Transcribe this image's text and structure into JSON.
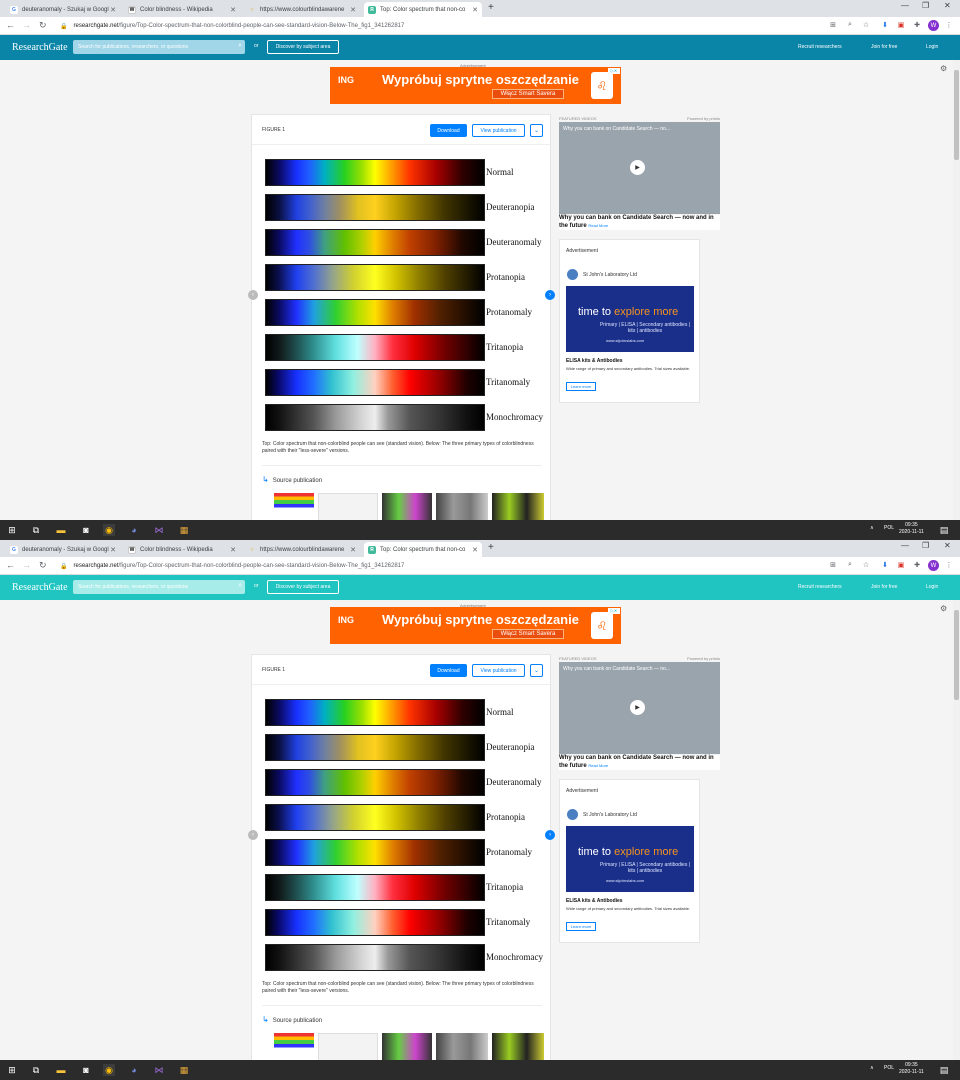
{
  "browser": {
    "tabs": [
      {
        "title": "deuteranomaly - Szukaj w Googl",
        "fav": "G",
        "fav_color": "#ffffff"
      },
      {
        "title": "Color blindness - Wikipedia",
        "fav": "W",
        "fav_color": "#ffffff"
      },
      {
        "title": "https://www.colourblindawarene",
        "fav": "☆",
        "fav_color": "#ffffff"
      },
      {
        "title": "Top: Color spectrum that non-co",
        "fav": "R",
        "fav_color": "#40ba9b"
      }
    ],
    "active_tab": 3,
    "url_host": "researchgate.net",
    "url_path": "/figure/Top-Color-spectrum-that-non-colorblind-people-can-see-standard-vision-Below-The_fig1_341262817",
    "avatar_letter": "W",
    "icons": [
      "back-icon",
      "forward-icon",
      "reload-icon",
      "lock-icon",
      "translate-icon",
      "zoom-icon",
      "star-icon",
      "download-icon",
      "pdf-icon",
      "extensions-icon",
      "menu-icon"
    ]
  },
  "rg": {
    "logo": "ResearchGate",
    "search_placeholder": "Search for publications, researchers, or questions",
    "or": "or",
    "discover": "Discover by subject area",
    "recruit": "Recruit researchers",
    "join": "Join for free",
    "login": "Login"
  },
  "ad_top": {
    "label": "Advertisement",
    "brand": "ING",
    "headline": "Wypróbuj sprytne oszczędzanie",
    "cta": "Włącz Smart Savera"
  },
  "figure": {
    "title": "FIGURE 1",
    "download": "Download",
    "view_publication": "View publication",
    "caption": "Top: Color spectrum that non-colorblind people can see (standard vision). Below: The three primary types of colorblindness paired with their \"less-severe\" versions.",
    "source_publication": "Source publication",
    "rows": [
      {
        "label": "Normal"
      },
      {
        "label": "Deuteranopia"
      },
      {
        "label": "Deuteranomaly"
      },
      {
        "label": "Protanopia"
      },
      {
        "label": "Protanomaly"
      },
      {
        "label": "Tritanopia"
      },
      {
        "label": "Tritanomaly"
      },
      {
        "label": "Monochromacy"
      }
    ]
  },
  "sidebar": {
    "featured_videos": "FEATURED VIDEOS",
    "powered_by": "Powered by primis",
    "video_overlay_title": "Why you can bank on Candidate Search — no...",
    "video_caption": "Why you can bank on Candidate Search — now and in the future",
    "read_more": "Read More",
    "ad_label": "Advertisement",
    "ad_company": "St John's Laboratory Ltd",
    "ad_tagline_a": "time to ",
    "ad_tagline_b": "explore more",
    "ad_sub": "Primary | ELISA | Secondary antibodies | kits | antibodies",
    "ad_url": "www.stjohnslabs.com",
    "ad_title": "ELISA kits & Antibodies",
    "ad_text": "Wide range of primary and secondary antibodies. Trial sizes available.",
    "ad_button": "Learn more"
  },
  "taskbar": {
    "lang": "POL",
    "time": "09:35",
    "date": "2020-11-11"
  },
  "colors": {
    "rg_header_screen1": "#0a85a8",
    "rg_header_screen2": "#20c4c1",
    "rg_search_screen1": "#a0d6e8",
    "rg_search_screen2": "#a7ece8",
    "accent": "#0080ff"
  }
}
